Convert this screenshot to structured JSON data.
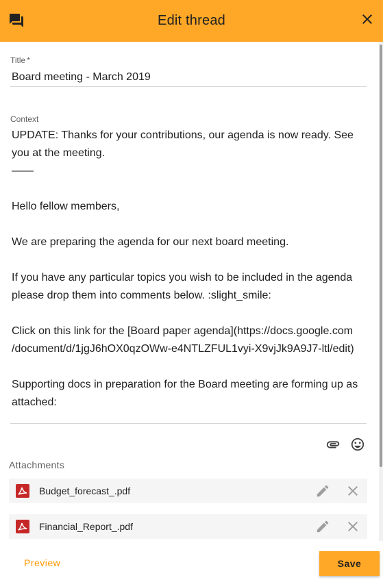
{
  "header": {
    "title": "Edit thread",
    "left_icon": "forum-icon",
    "close_icon": "close-icon"
  },
  "form": {
    "title_label": "Title",
    "required_mark": "*",
    "title_value": "Board meeting - March 2019",
    "context_label": "Context",
    "context_lines": [
      "UPDATE: Thanks for your contributions, our agenda is now ready. See",
      "you at the meeting.",
      "——",
      "",
      "Hello fellow members,",
      "",
      "We are preparing the agenda for our next board meeting.",
      "",
      "If you have any particular topics you wish to be included in the agenda",
      "please drop them into comments below. :slight_smile:",
      "",
      "Click on this link for the [Board paper agenda](https://docs.google.com",
      "/document/d/1jgJ6hOX0qzOWw-e4NTLZFUL1vyi-X9vjJk9A9J7-ltl/edit)",
      "",
      "Supporting docs in preparation for the Board meeting are forming up as",
      "attached:"
    ]
  },
  "toolbar": {
    "attach_icon": "paperclip-icon",
    "emoji_icon": "emoji-icon"
  },
  "attachments": {
    "label": "Attachments",
    "items": [
      {
        "name": "Budget_forecast_.pdf",
        "icon": "pdf-icon"
      },
      {
        "name": "Financial_Report_.pdf",
        "icon": "pdf-icon"
      }
    ]
  },
  "footer": {
    "preview_label": "Preview",
    "save_label": "Save"
  },
  "colors": {
    "accent": "#ffa726",
    "preview_text": "#ff9800",
    "pdf_red": "#c62828"
  }
}
